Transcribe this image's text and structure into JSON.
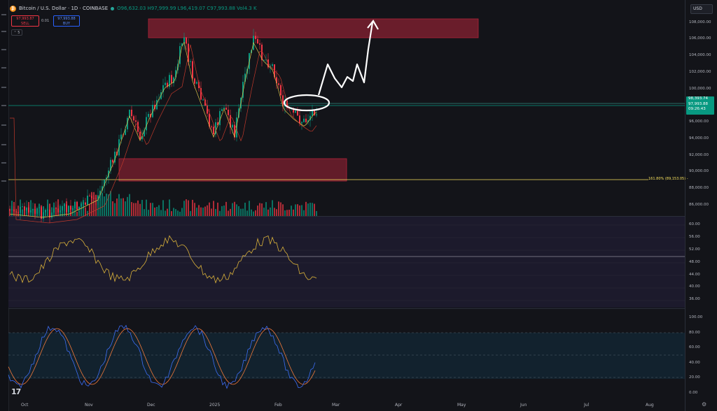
{
  "header": {
    "symbol": "Bitcoin / U.S. Dollar · 1D · COINBASE",
    "open": "O96,632.03",
    "high": "H97,999.99",
    "low": "L96,419.07",
    "close": "C97,993.88",
    "volume": "Vol4.3 K"
  },
  "trade": {
    "sell_price": "97,993.87",
    "sell_label": "SELL",
    "spread": "0.01",
    "buy_price": "97,993.88",
    "buy_label": "BUY"
  },
  "indicators_count": "5",
  "currency": "USD",
  "price_axis": [
    "108,000.00",
    "106,000.00",
    "104,000.00",
    "102,000.00",
    "100,000.00",
    "96,000.00",
    "94,000.00",
    "92,000.00",
    "90,000.00",
    "88,000.00",
    "86,000.00"
  ],
  "price_tag": {
    "top": "98,393.74",
    "last": "97,993.88",
    "countdown": "09:26:43"
  },
  "fib_label": "161.80% (89,153.05) -",
  "rsi_axis": [
    "60.00",
    "56.00",
    "52.00",
    "48.00",
    "44.00",
    "40.00",
    "36.00"
  ],
  "stoch_axis": [
    "100.00",
    "80.00",
    "60.00",
    "40.00",
    "20.00",
    "0.00"
  ],
  "time_axis": [
    "Oct",
    "Nov",
    "Dec",
    "2025",
    "Feb",
    "Mar",
    "Apr",
    "May",
    "Jun",
    "Jul",
    "Aug"
  ],
  "colors": {
    "up": "#089981",
    "down": "#f23645",
    "zone": "#b2243a",
    "fib": "#f7e15d",
    "rsi": "#d9b13a",
    "stoch_k": "#3d6ef5",
    "stoch_d": "#f0793a",
    "annotation": "#ffffff"
  },
  "icons": {
    "settings": "gear-icon",
    "logo": "tradingview-logo"
  }
}
